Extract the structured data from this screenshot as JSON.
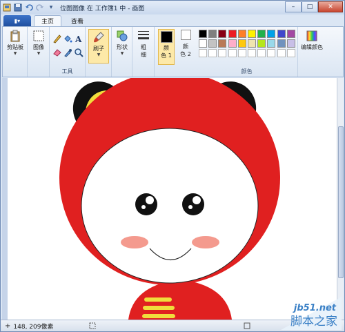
{
  "window": {
    "title": "位图图像 在 工作簿1 中 - 画图",
    "controls": [
      "–",
      "□",
      "✕"
    ]
  },
  "quick_access": [
    "paint-app-icon",
    "save-icon",
    "undo-icon",
    "redo-icon",
    "customize-dropdown-icon"
  ],
  "tabs": {
    "file_icon": "▮▾",
    "items": [
      "主页",
      "查看"
    ],
    "active": "主页"
  },
  "ribbon": {
    "clipboard_label": "剪贴板",
    "image_label": "图像",
    "tools_group_label": "工具",
    "brush_label": "刷子",
    "shapes_label": "形状",
    "size_label": "粗\n细",
    "color1_label": "颜\n色 1",
    "color2_label": "颜\n色 2",
    "colors_group_label": "颜色",
    "edit_colors_label": "编辑颜色",
    "color1_value": "#000000",
    "color2_value": "#ffffff",
    "palette": [
      "#000000",
      "#7f7f7f",
      "#880015",
      "#ed1c24",
      "#ff7f27",
      "#fff200",
      "#22b14c",
      "#00a2e8",
      "#3f48cc",
      "#a349a4",
      "#ffffff",
      "#c3c3c3",
      "#b97a57",
      "#ffaec9",
      "#ffc90e",
      "#efe4b0",
      "#b5e61d",
      "#99d9ea",
      "#7092be",
      "#c8bfe7",
      "#ffffff",
      "#ffffff",
      "#ffffff",
      "#ffffff",
      "#ffffff",
      "#ffffff",
      "#ffffff",
      "#ffffff",
      "#ffffff",
      "#ffffff"
    ]
  },
  "status": {
    "coords": "148, 209像素"
  },
  "watermark": {
    "site": "jb51.net",
    "name": "脚本之家"
  }
}
